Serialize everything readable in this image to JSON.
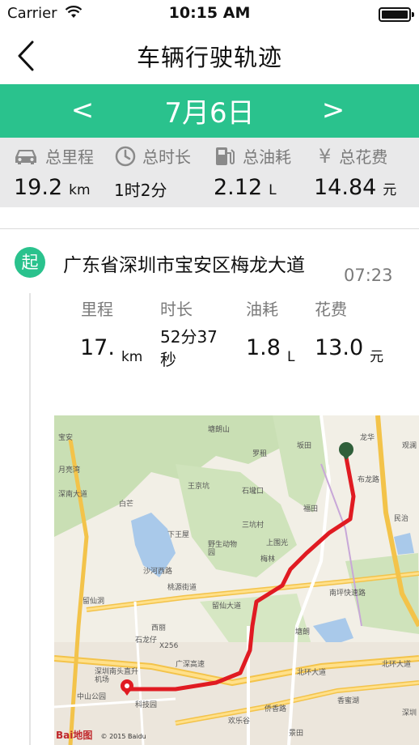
{
  "status_bar": {
    "carrier": "Carrier",
    "time": "10:15 AM"
  },
  "nav": {
    "title": "车辆行驶轨迹",
    "back_icon": "chevron-left-icon"
  },
  "date_bar": {
    "prev": "<",
    "date": "7月6日",
    "next": ">",
    "color": "#2ac28d"
  },
  "summary": {
    "mileage": {
      "label": "总里程",
      "value": "19.2",
      "unit": "km",
      "icon": "car-icon"
    },
    "duration": {
      "label": "总时长",
      "value": "1时2分",
      "icon": "clock-icon"
    },
    "fuel": {
      "label": "总油耗",
      "value": "2.12",
      "unit": "L",
      "icon": "fuel-pump-icon"
    },
    "cost": {
      "label": "总花费",
      "value": "14.84",
      "unit": "元",
      "icon": "yen-icon"
    }
  },
  "trip": {
    "badge": "起",
    "address": "广东省深圳市宝安区梅龙大道",
    "time": "07:23",
    "labels": {
      "mileage": "里程",
      "duration": "时长",
      "fuel": "油耗",
      "cost": "花费"
    },
    "mileage": {
      "value": "17.",
      "unit": "km"
    },
    "duration": {
      "line1": "52分37",
      "line2": "秒"
    },
    "fuel": {
      "value": "1.8",
      "unit": "L"
    },
    "cost": {
      "value": "13.0",
      "unit": "元"
    }
  },
  "map": {
    "labels": [
      "塘朗山",
      "桃源街道",
      "西丽",
      "留仙洞",
      "中山公园",
      "科技园",
      "深圳南头直升机场",
      "欢乐谷",
      "侨香路",
      "北环大道",
      "北环大道",
      "香蜜湖",
      "景田",
      "深圳",
      "布龙路",
      "龙华",
      "民治",
      "梅林",
      "福田",
      "塘朗",
      "罗租",
      "王京坑",
      "白芒",
      "石壠口",
      "三坑村",
      "下王屋",
      "上围光",
      "南坪快速路",
      "野生动物园",
      "坂田",
      "观澜",
      "X256",
      "广深高速",
      "沙河西路",
      "留仙大道",
      "月亮湾",
      "深南大道",
      "石龙仔",
      "宝安"
    ],
    "attribution": "Bai地图",
    "copyright": "© 2015 Baidu",
    "route_color": "#e01b22",
    "start_marker_color": "#2f5f3a",
    "end_marker_color": "#e01b22"
  }
}
